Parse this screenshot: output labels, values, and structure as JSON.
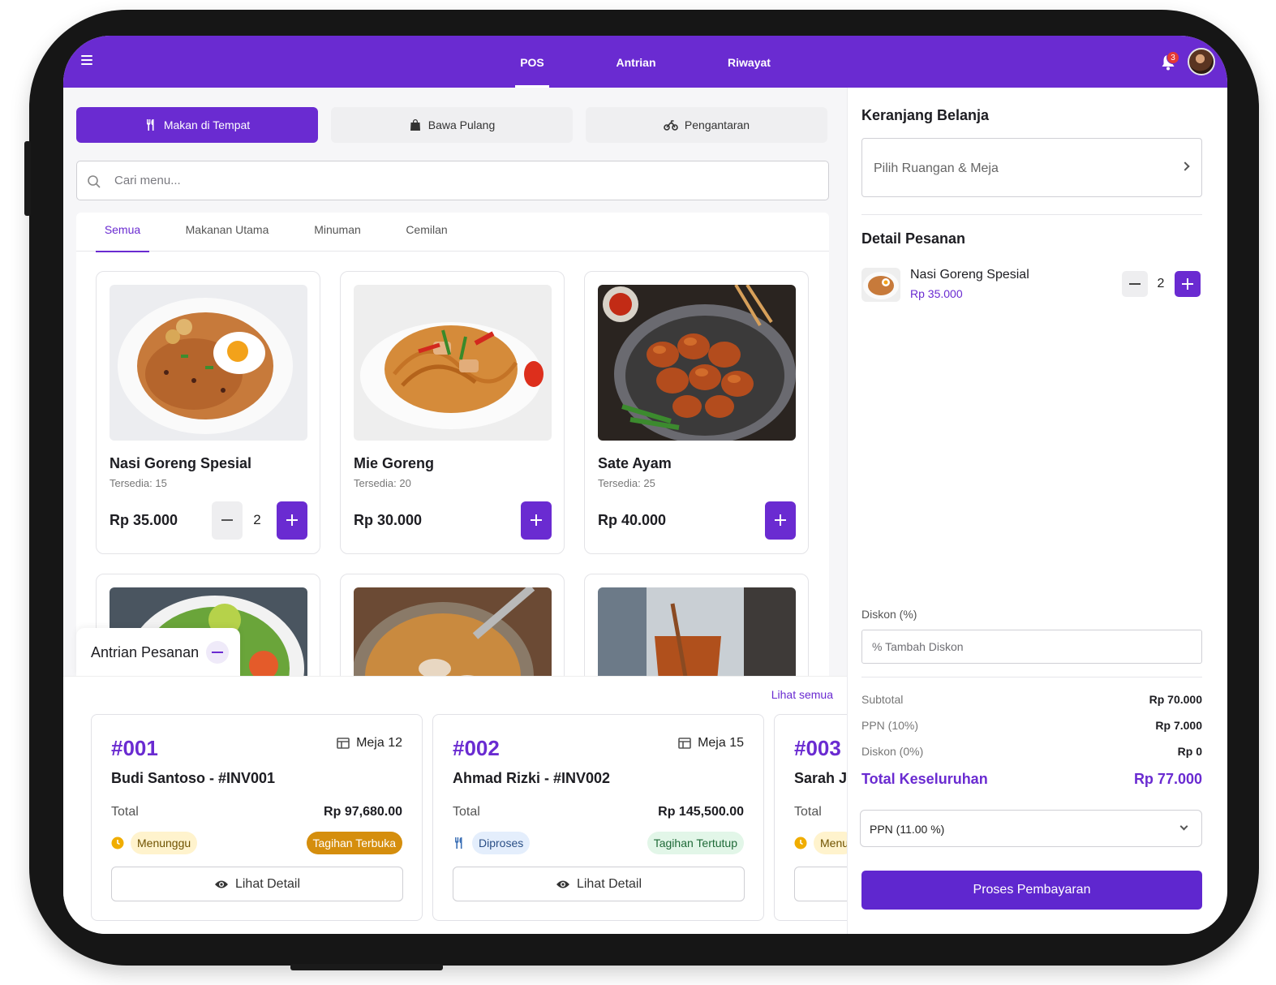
{
  "topbar": {
    "tabs": [
      "POS",
      "Antrian Pesanan",
      "Riwayat"
    ],
    "notification_count": "3"
  },
  "order_types": [
    "Makan di Tempat",
    "Bawa Pulang",
    "Pengantaran"
  ],
  "search": {
    "placeholder": "Cari menu..."
  },
  "categories": [
    "Semua",
    "Makanan Utama",
    "Minuman",
    "Cemilan"
  ],
  "menu_items": [
    {
      "name": "Nasi Goreng Spesial",
      "stock": "Tersedia: 15",
      "price": "Rp 35.000",
      "qty": "2"
    },
    {
      "name": "Mie Goreng",
      "stock": "Tersedia: 20",
      "price": "Rp 30.000"
    },
    {
      "name": "Sate Ayam",
      "stock": "Tersedia: 25",
      "price": "Rp 40.000"
    }
  ],
  "queue": {
    "title": "Antrian Pesanan",
    "see_all": "Lihat semua",
    "orders": [
      {
        "number": "#001",
        "table": "Meja 12",
        "customer": "Budi Santoso - #INV001",
        "total_label": "Total",
        "total": "Rp 97,680.00",
        "status": "Menunggu",
        "bill": "Tagihan Terbuka",
        "detail": "Lihat Detail"
      },
      {
        "number": "#002",
        "table": "Meja 15",
        "customer": "Ahmad Rizki - #INV002",
        "total_label": "Total",
        "total": "Rp 145,500.00",
        "status": "Diproses",
        "bill": "Tagihan Tertutup",
        "detail": "Lihat Detail"
      },
      {
        "number": "#003",
        "customer": "Sarah Jo",
        "total_label": "Total",
        "status": "Menu"
      }
    ]
  },
  "cart": {
    "title": "Keranjang Belanja",
    "room_placeholder": "Pilih Ruangan & Meja",
    "detail_title": "Detail Pesanan",
    "items": [
      {
        "name": "Nasi Goreng Spesial",
        "price": "Rp 35.000",
        "qty": "2"
      }
    ],
    "discount_label": "Diskon (%)",
    "discount_placeholder": "% Tambah Diskon",
    "subtotal_label": "Subtotal",
    "subtotal": "Rp 70.000",
    "tax_label": "PPN (10%)",
    "tax": "Rp 7.000",
    "discount_row_label": "Diskon (0%)",
    "discount_value": "Rp 0",
    "grand_label": "Total Keseluruhan",
    "grand_total": "Rp 77.000",
    "tax_select": "PPN (11.00 %)",
    "pay_button": "Proses Pembayaran"
  },
  "colors": {
    "accent": "#6a2bd1",
    "pending": "#d58e0d",
    "closed": "#1f6a38"
  }
}
